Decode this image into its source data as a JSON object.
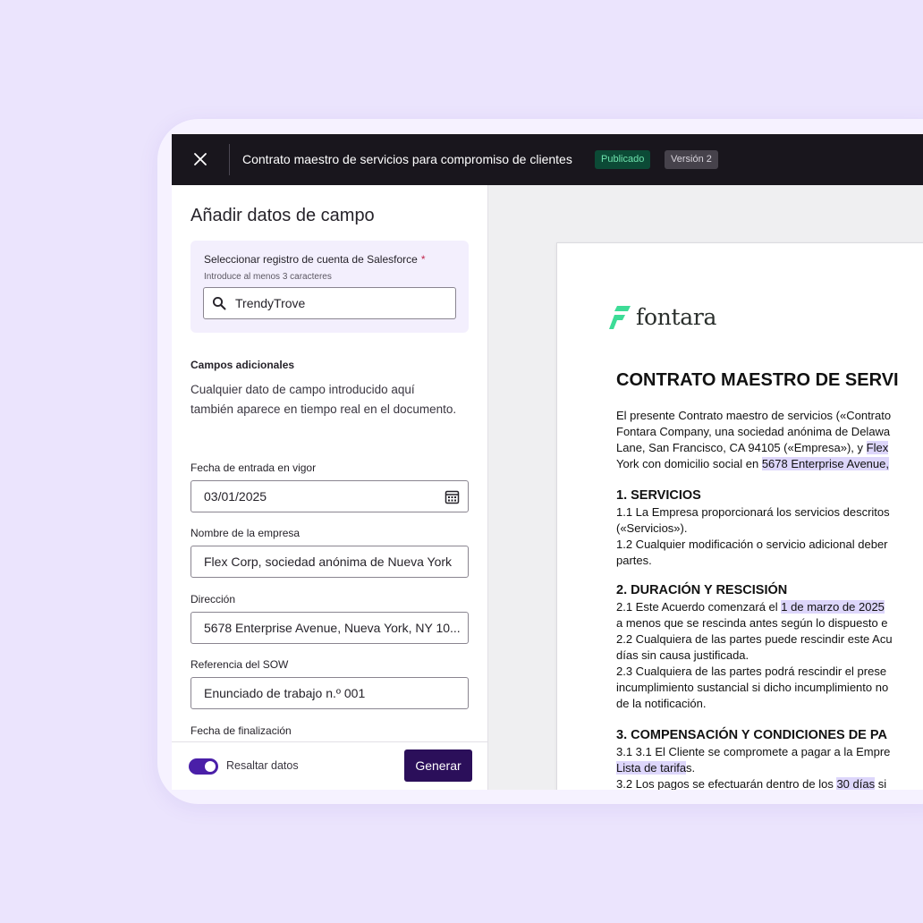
{
  "topbar": {
    "title": "Contrato maestro de servicios para compromiso de clientes",
    "status_badge": "Publicado",
    "version_badge": "Versión 2"
  },
  "panel": {
    "heading": "Añadir datos de campo",
    "salesforce": {
      "label": "Seleccionar registro de cuenta de Salesforce",
      "required_mark": "*",
      "hint": "Introduce al menos 3 caracteres",
      "value": "TrendyTrove"
    },
    "additional": {
      "title": "Campos adicionales",
      "description": "Cualquier dato de campo introducido aquí también aparece en tiempo real en el documento."
    },
    "fields": [
      {
        "label": "Fecha de entrada en vigor",
        "value": "03/01/2025"
      },
      {
        "label": "Nombre de la empresa",
        "value": "Flex Corp, sociedad anónima de Nueva York"
      },
      {
        "label": "Dirección",
        "value": "5678 Enterprise Avenue, Nueva York, NY 10..."
      },
      {
        "label": "Referencia del SOW",
        "value": "Enunciado de trabajo n.º 001"
      },
      {
        "label": "Fecha de finalización"
      }
    ],
    "highlight_toggle": {
      "label": "Resaltar datos",
      "on": true
    },
    "generate_button": "Generar"
  },
  "document": {
    "logo_text": "fontara",
    "title": "CONTRATO MAESTRO DE SERVI",
    "intro": {
      "l1": "El presente Contrato maestro de servicios («Contrato",
      "l2": "Fontara Company, una sociedad anónima de Delawa",
      "l3a": "Lane, San Francisco, CA 94105 («Empresa»), y ",
      "l3b": "Flex",
      "l4a": "York con domicilio social en ",
      "l4b": "5678 Enterprise Avenue,"
    },
    "s1": {
      "heading": "1. SERVICIOS",
      "l1": "1.1 La Empresa proporcionará los servicios descritos",
      "l2": "(«Servicios»).",
      "l3": "1.2 Cualquier modificación o servicio adicional deber",
      "l4": "partes."
    },
    "s2": {
      "heading": "2. DURACIÓN Y RESCISIÓN",
      "l1a": "2.1 Este Acuerdo comenzará el ",
      "l1b": "1 de marzo de 2025",
      "l2": "a menos que se rescinda antes según lo dispuesto e",
      "l3": "2.2 Cualquiera de las partes puede rescindir este Acu",
      "l4": "días sin causa justificada.",
      "l5": "2.3 Cualquiera de las partes podrá rescindir el prese",
      "l6": "incumplimiento sustancial si dicho incumplimiento no",
      "l7": "de la notificación."
    },
    "s3": {
      "heading": "3. COMPENSACIÓN Y CONDICIONES DE PA",
      "l1": "3.1 3.1 El Cliente se compromete a pagar a la Empre",
      "l2a": "Lista de tarifa",
      "l2b": "s.",
      "l3a": "3.2 Los pagos se efectuarán dentro de los ",
      "l3b": "30 días",
      "l3c": " si"
    }
  },
  "colors": {
    "background": "#ebe4fd",
    "topbar": "#19161d",
    "accent": "#4a1fa8",
    "button": "#2b0f5a",
    "highlight": "#ddd6fb",
    "logo_green": "#3ddc97"
  }
}
